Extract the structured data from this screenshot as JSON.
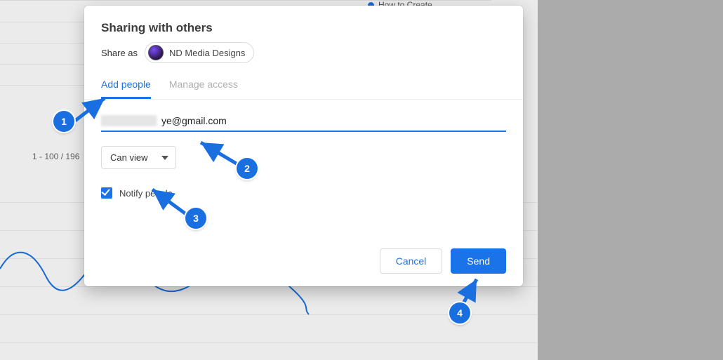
{
  "legend": {
    "label": "How to Create"
  },
  "pagination": "1 - 100 / 196",
  "dialog": {
    "title": "Sharing with others",
    "share_as_label": "Share as",
    "share_as_name": "ND Media Designs",
    "tabs": {
      "add_people": "Add people",
      "manage_access": "Manage access"
    },
    "email_suffix": "ye@gmail.com",
    "permission": "Can view",
    "notify_label": "Notify people",
    "notify_checked": true,
    "cancel": "Cancel",
    "send": "Send"
  },
  "annotations": {
    "a1": "1",
    "a2": "2",
    "a3": "3",
    "a4": "4"
  },
  "colors": {
    "primary": "#1a73e8"
  }
}
